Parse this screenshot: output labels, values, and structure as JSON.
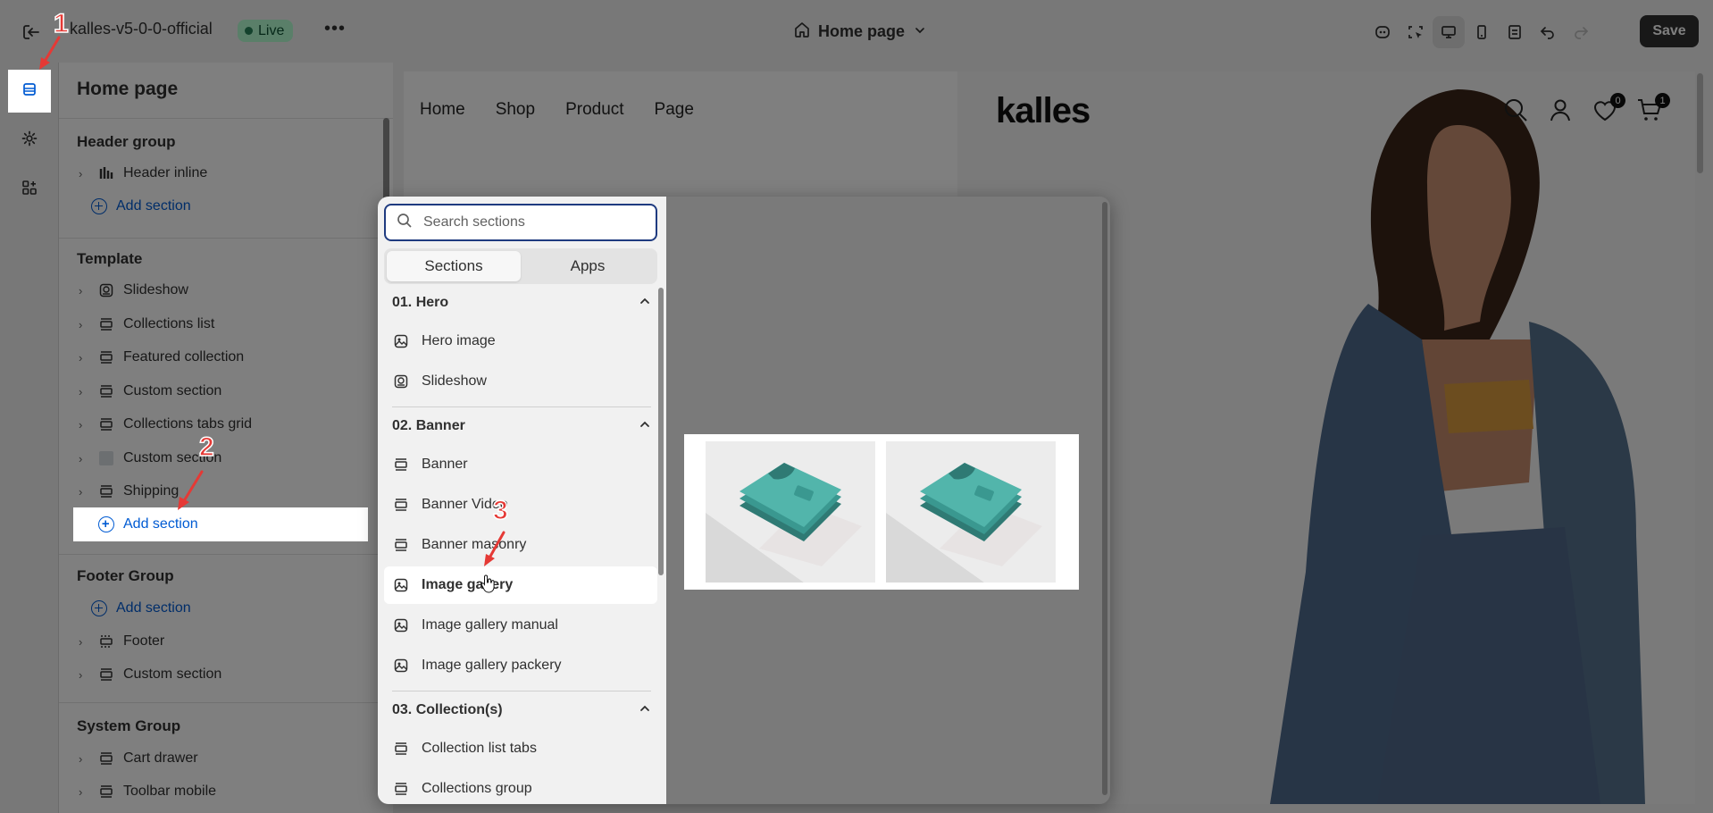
{
  "topbar": {
    "store_name": "kalles-v5-0-0-official",
    "live_label": "Live",
    "more_label": "•••",
    "page_label": "Home page",
    "save_label": "Save"
  },
  "sidebar": {
    "title": "Home page",
    "header_group": {
      "title": "Header group",
      "items": [
        {
          "label": "Header inline"
        }
      ],
      "add_label": "Add section"
    },
    "template": {
      "title": "Template",
      "items": [
        {
          "label": "Slideshow"
        },
        {
          "label": "Collections list"
        },
        {
          "label": "Featured collection"
        },
        {
          "label": "Custom section"
        },
        {
          "label": "Collections tabs grid"
        },
        {
          "label": "Custom section"
        },
        {
          "label": "Shipping"
        }
      ],
      "add_label": "Add section"
    },
    "footer_group": {
      "title": "Footer Group",
      "add_label": "Add section",
      "items": [
        {
          "label": "Footer"
        },
        {
          "label": "Custom section"
        }
      ]
    },
    "system_group": {
      "title": "System Group",
      "items": [
        {
          "label": "Cart drawer"
        },
        {
          "label": "Toolbar mobile"
        }
      ]
    }
  },
  "preview": {
    "nav": [
      "Home",
      "Shop",
      "Product",
      "Page"
    ],
    "logo": "kalles",
    "wishlist_count": "0",
    "cart_count": "1"
  },
  "picker": {
    "search_placeholder": "Search sections",
    "tabs": [
      "Sections",
      "Apps"
    ],
    "categories": [
      {
        "title": "01. Hero",
        "items": [
          "Hero image",
          "Slideshow"
        ]
      },
      {
        "title": "02. Banner",
        "items": [
          "Banner",
          "Banner Video",
          "Banner masonry",
          "Image gallery",
          "Image gallery manual",
          "Image gallery packery"
        ]
      },
      {
        "title": "03. Collection(s)",
        "items": [
          "Collection list tabs",
          "Collections group"
        ]
      }
    ],
    "selected": "Image gallery"
  },
  "steps": [
    "1",
    "2",
    "3"
  ],
  "colors": {
    "accent_blue": "#005bd3",
    "live_bg": "#b4fed2",
    "annotation_red": "#e53935",
    "save_bg": "#303030"
  }
}
